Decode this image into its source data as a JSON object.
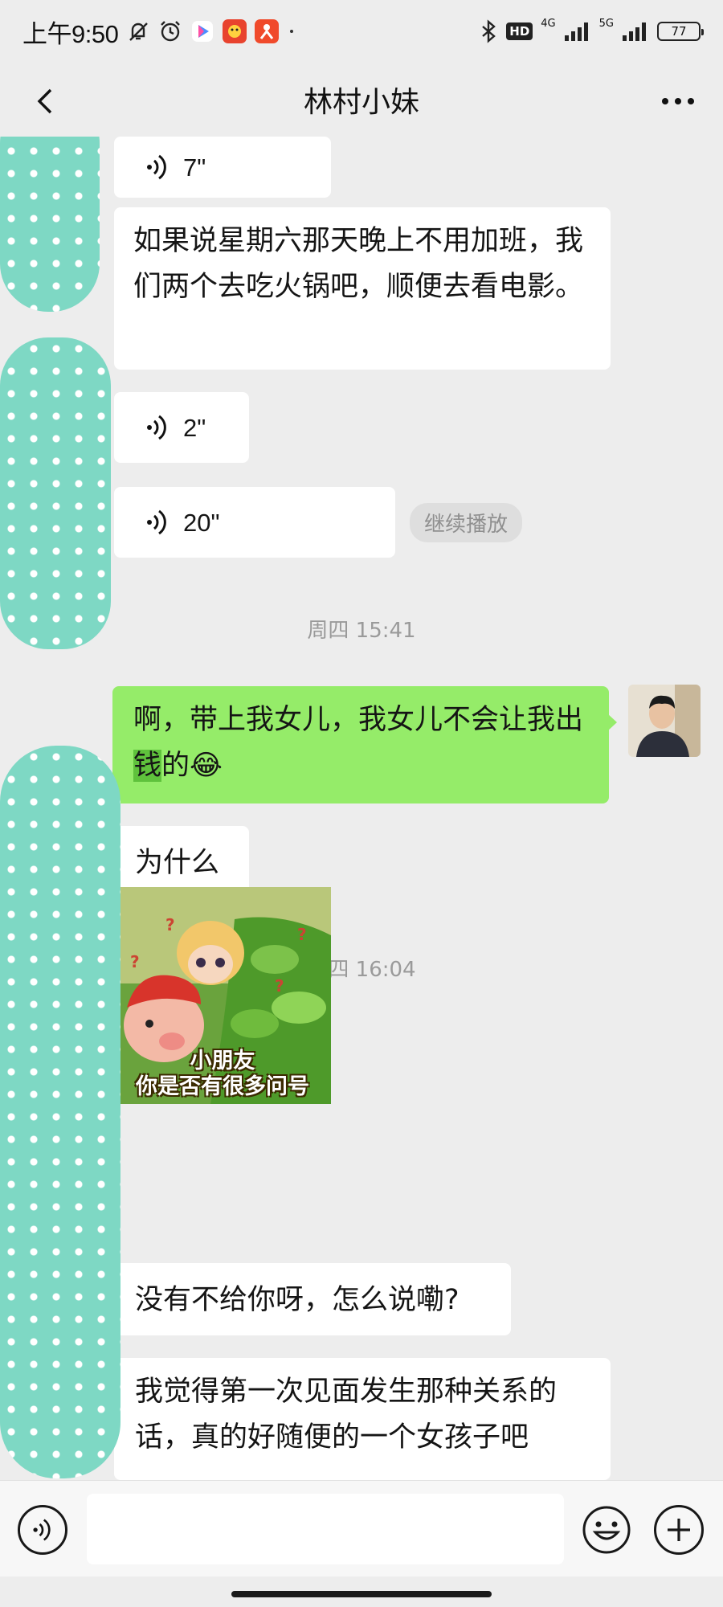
{
  "status_bar": {
    "time": "上午9:50",
    "network_hd": "HD",
    "network_4g": "4G",
    "network_5g": "5G",
    "battery": "77"
  },
  "header": {
    "title": "林村小妹"
  },
  "messages": [
    {
      "type": "voice",
      "side": "left",
      "duration": "7\""
    },
    {
      "type": "text",
      "side": "left",
      "text": "如果说星期六那天晚上不用加班，我们两个去吃火锅吧，顺便去看电影。"
    },
    {
      "type": "voice",
      "side": "left",
      "duration": "2\""
    },
    {
      "type": "voice",
      "side": "left",
      "duration": "20\"",
      "action": "继续播放"
    },
    {
      "type": "timestamp",
      "text": "周四 15:41"
    },
    {
      "type": "text",
      "side": "right",
      "text_before": "啊，带上我女儿，我女儿不会让我出",
      "highlight": "钱",
      "text_after": "的",
      "emoji": "😂"
    },
    {
      "type": "text",
      "side": "left",
      "text": "为什么"
    },
    {
      "type": "timestamp",
      "text": "周四 16:04"
    },
    {
      "type": "sticker",
      "side": "left",
      "caption_line1": "小朋友",
      "caption_line2": "你是否有很多问号"
    },
    {
      "type": "text",
      "side": "left",
      "text": "没有不给你呀，怎么说嘞?"
    },
    {
      "type": "text",
      "side": "left",
      "text": "我觉得第一次见面发生那种关系的话，真的好随便的一个女孩子吧"
    }
  ],
  "input_bar": {
    "placeholder": "",
    "voice_icon": "voice-input-icon",
    "emoji_icon": "emoji-icon",
    "plus_icon": "plus-icon"
  },
  "colors": {
    "background": "#ededed",
    "bubble_left": "#ffffff",
    "bubble_right": "#95ec69",
    "mask": "#7ed8c4"
  }
}
